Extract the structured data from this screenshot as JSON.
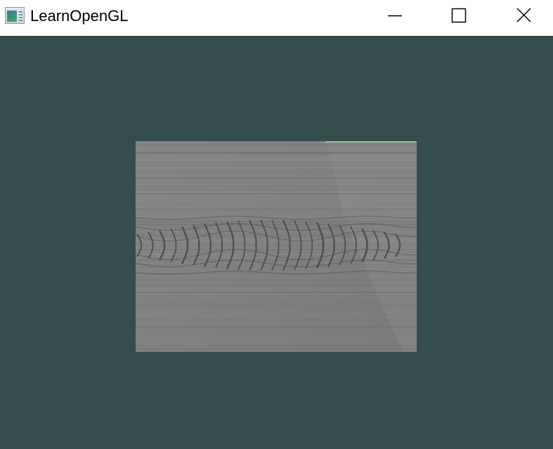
{
  "window": {
    "title": "LearnOpenGL",
    "icon": "application-window-icon",
    "controls": {
      "minimize_icon": "minimize-icon",
      "maximize_icon": "maximize-icon",
      "close_icon": "close-icon"
    }
  },
  "viewport": {
    "clear_color": "#334d4d",
    "texture": "wood-grain-texture"
  },
  "colors": {
    "titlebar_bg": "#ffffff",
    "wood_base": "#8a8a8a",
    "wood_grain_dark": "#4a4a4a"
  }
}
